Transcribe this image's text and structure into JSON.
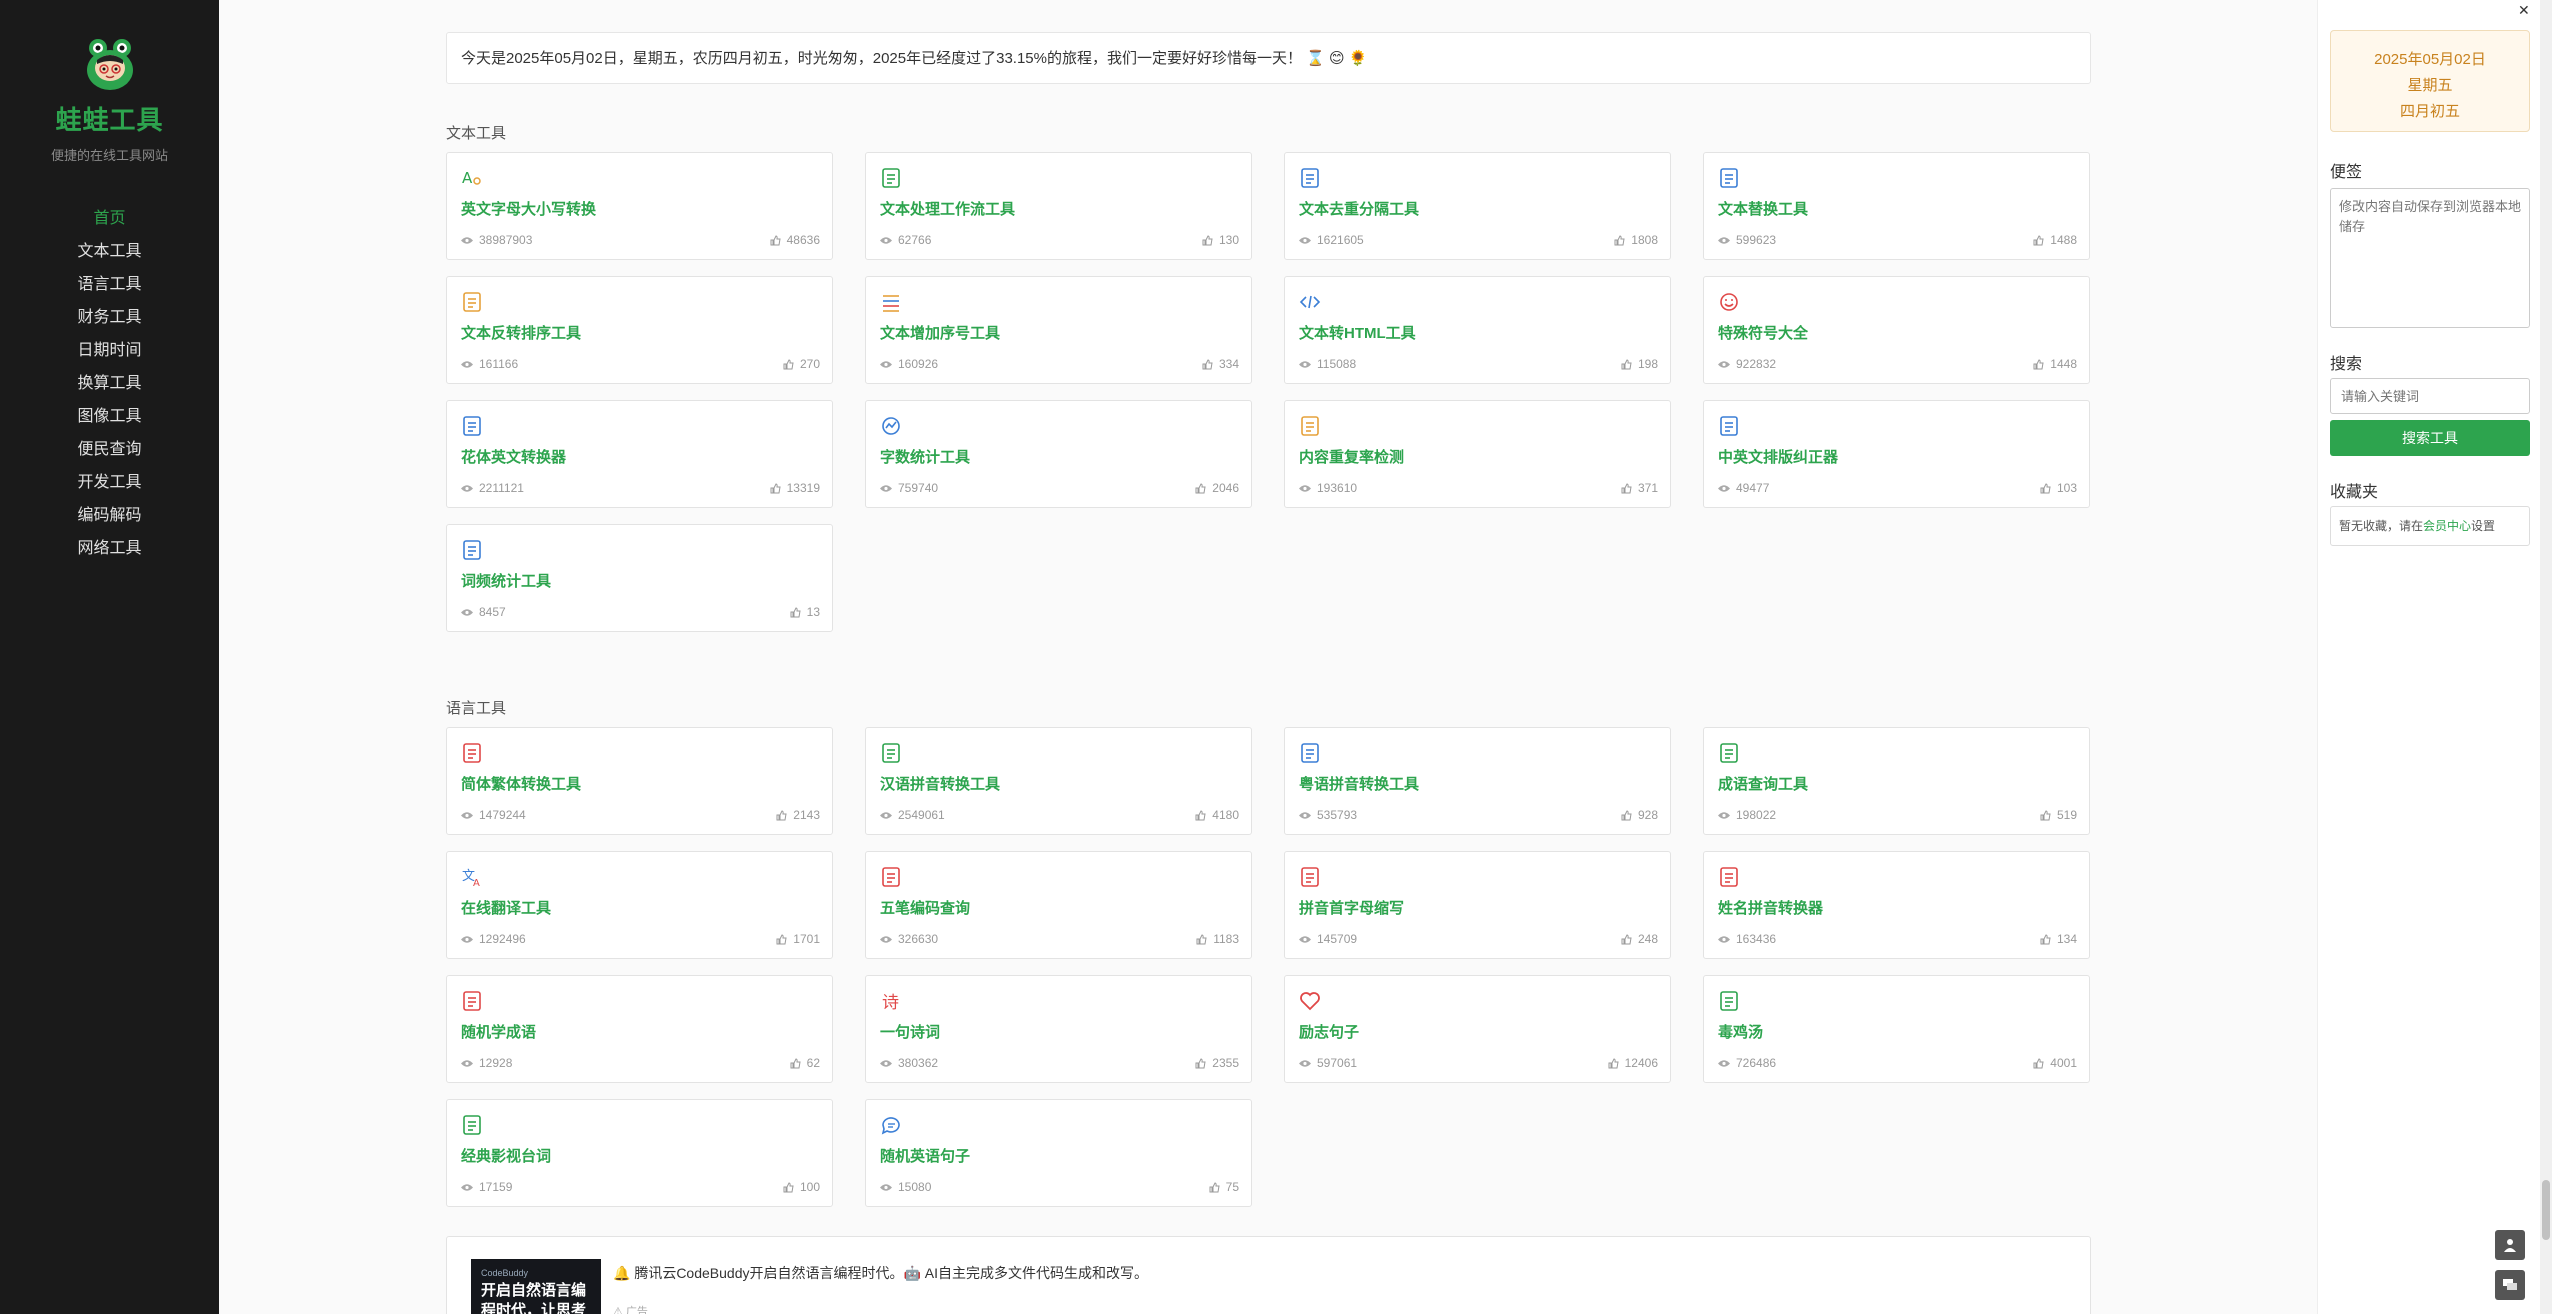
{
  "sidebar": {
    "brand": "蛙蛙工具",
    "slogan": "便捷的在线工具网站",
    "nav": [
      "首页",
      "文本工具",
      "语言工具",
      "财务工具",
      "日期时间",
      "换算工具",
      "图像工具",
      "便民查询",
      "开发工具",
      "编码解码",
      "网络工具"
    ]
  },
  "banner": {
    "text": "今天是2025年05月02日，星期五，农历四月初五，时光匆匆，2025年已经度过了33.15%的旅程，我们一定要好好珍惜每一天！ ⌛ 😊 🌻"
  },
  "sections": [
    {
      "title": "文本工具",
      "cards": [
        {
          "title": "英文字母大小写转换",
          "views": "38987903",
          "likes": "48636",
          "icon": "font-case-icon",
          "color": "#2da44e"
        },
        {
          "title": "文本处理工作流工具",
          "views": "62766",
          "likes": "130",
          "icon": "workflow-icon",
          "color": "#2da44e"
        },
        {
          "title": "文本去重分隔工具",
          "views": "1621605",
          "likes": "1808",
          "icon": "document-icon",
          "color": "#3c7fd6"
        },
        {
          "title": "文本替换工具",
          "views": "599623",
          "likes": "1488",
          "icon": "replace-icon",
          "color": "#3c7fd6"
        },
        {
          "title": "文本反转排序工具",
          "views": "161166",
          "likes": "270",
          "icon": "reverse-icon",
          "color": "#e6a23c"
        },
        {
          "title": "文本增加序号工具",
          "views": "160926",
          "likes": "334",
          "icon": "numbered-list-icon",
          "color": "#e6a23c"
        },
        {
          "title": "文本转HTML工具",
          "views": "115088",
          "likes": "198",
          "icon": "code-icon",
          "color": "#3c7fd6"
        },
        {
          "title": "特殊符号大全",
          "views": "922832",
          "likes": "1448",
          "icon": "smiley-icon",
          "color": "#e04848"
        },
        {
          "title": "花体英文转换器",
          "views": "2211121",
          "likes": "13319",
          "icon": "fancy-font-icon",
          "color": "#3c7fd6"
        },
        {
          "title": "字数统计工具",
          "views": "759740",
          "likes": "2046",
          "icon": "chart-icon",
          "color": "#3c7fd6"
        },
        {
          "title": "内容重复率检测",
          "views": "193610",
          "likes": "371",
          "icon": "compare-icon",
          "color": "#e6a23c"
        },
        {
          "title": "中英文排版纠正器",
          "views": "49477",
          "likes": "103",
          "icon": "layout-icon",
          "color": "#3c7fd6"
        },
        {
          "title": "词频统计工具",
          "views": "8457",
          "likes": "13",
          "icon": "frequency-icon",
          "color": "#3c7fd6"
        }
      ]
    },
    {
      "title": "语言工具",
      "cards": [
        {
          "title": "简体繁体转换工具",
          "views": "1479244",
          "likes": "2143",
          "icon": "simplified-traditional-icon",
          "color": "#e04848"
        },
        {
          "title": "汉语拼音转换工具",
          "views": "2549061",
          "likes": "4180",
          "icon": "pinyin-icon",
          "color": "#2da44e"
        },
        {
          "title": "粤语拼音转换工具",
          "views": "535793",
          "likes": "928",
          "icon": "cantonese-icon",
          "color": "#3c7fd6"
        },
        {
          "title": "成语查询工具",
          "views": "198022",
          "likes": "519",
          "icon": "idiom-icon",
          "color": "#2da44e"
        },
        {
          "title": "在线翻译工具",
          "views": "1292496",
          "likes": "1701",
          "icon": "translate-icon",
          "color": "#3c7fd6"
        },
        {
          "title": "五笔编码查询",
          "views": "326630",
          "likes": "1183",
          "icon": "wubi-icon",
          "color": "#e04848"
        },
        {
          "title": "拼音首字母缩写",
          "views": "145709",
          "likes": "248",
          "icon": "initials-icon",
          "color": "#e04848"
        },
        {
          "title": "姓名拼音转换器",
          "views": "163436",
          "likes": "134",
          "icon": "name-icon",
          "color": "#e04848"
        },
        {
          "title": "随机学成语",
          "views": "12928",
          "likes": "62",
          "icon": "book-icon",
          "color": "#e04848"
        },
        {
          "title": "一句诗词",
          "views": "380362",
          "likes": "2355",
          "icon": "poem-icon",
          "color": "#e04848"
        },
        {
          "title": "励志句子",
          "views": "597061",
          "likes": "12406",
          "icon": "heart-icon",
          "color": "#e04848"
        },
        {
          "title": "毒鸡汤",
          "views": "726486",
          "likes": "4001",
          "icon": "bowl-icon",
          "color": "#2da44e"
        },
        {
          "title": "经典影视台词",
          "views": "17159",
          "likes": "100",
          "icon": "film-icon",
          "color": "#2da44e"
        },
        {
          "title": "随机英语句子",
          "views": "15080",
          "likes": "75",
          "icon": "chat-icon",
          "color": "#3c7fd6"
        }
      ]
    }
  ],
  "ad": {
    "image_brand": "CodeBuddy",
    "image_text": "开启自然语言编程时代，让思考落地",
    "text": "🔔 腾讯云CodeBuddy开启自然语言编程时代。🤖 AI自主完成多文件代码生成和改写。",
    "tag": "⚠ 广告"
  },
  "rightbar": {
    "date": "2025年05月02日",
    "weekday": "星期五",
    "lunar": "四月初五",
    "memo_label": "便签",
    "memo_placeholder": "修改内容自动保存到浏览器本地储存",
    "search_label": "搜索",
    "search_placeholder": "请输入关键词",
    "search_button": "搜索工具",
    "fav_label": "收藏夹",
    "fav_text_pre": "暂无收藏，请在",
    "fav_link": "会员中心",
    "fav_text_post": "设置"
  },
  "window": {
    "close": "✕"
  },
  "colors": {
    "accent": "#2da44e",
    "sidebar_bg": "#1a1a1a"
  }
}
